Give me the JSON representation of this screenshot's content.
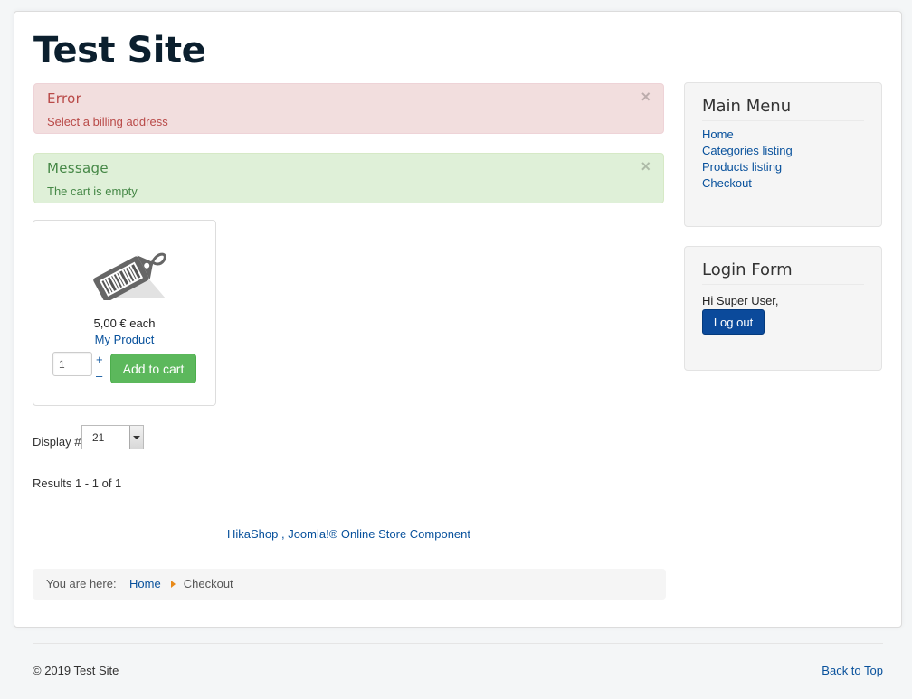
{
  "site": {
    "title": "Test Site"
  },
  "alerts": {
    "error": {
      "heading": "Error",
      "message": "Select a billing address",
      "close": "×"
    },
    "message": {
      "heading": "Message",
      "message": "The cart is empty",
      "close": "×"
    }
  },
  "product": {
    "price": "5,00 € each",
    "name": "My Product",
    "quantity": "1",
    "plus": "+",
    "minus": "–",
    "add_to_cart": "Add to cart",
    "image_icon": "price-tag-icon"
  },
  "listing": {
    "display_label": "Display #",
    "display_value": "21",
    "results": "Results 1 - 1 of 1",
    "powered_by": "HikaShop , Joomla!® Online Store Component"
  },
  "breadcrumb": {
    "prefix": "You are here:",
    "items": [
      "Home",
      "Checkout"
    ]
  },
  "sidebar": {
    "main_menu": {
      "title": "Main Menu",
      "items": [
        "Home",
        "Categories listing",
        "Products listing",
        "Checkout"
      ]
    },
    "login": {
      "title": "Login Form",
      "greeting": "Hi Super User,",
      "logout": "Log out"
    }
  },
  "footer": {
    "copyright": "© 2019 Test Site",
    "back_to_top": "Back to Top"
  },
  "colors": {
    "error_bg": "#f2dede",
    "success_bg": "#dff0d8",
    "add_to_cart": "#5cb85c",
    "logout": "#0b4a9b",
    "link": "#08519c"
  }
}
